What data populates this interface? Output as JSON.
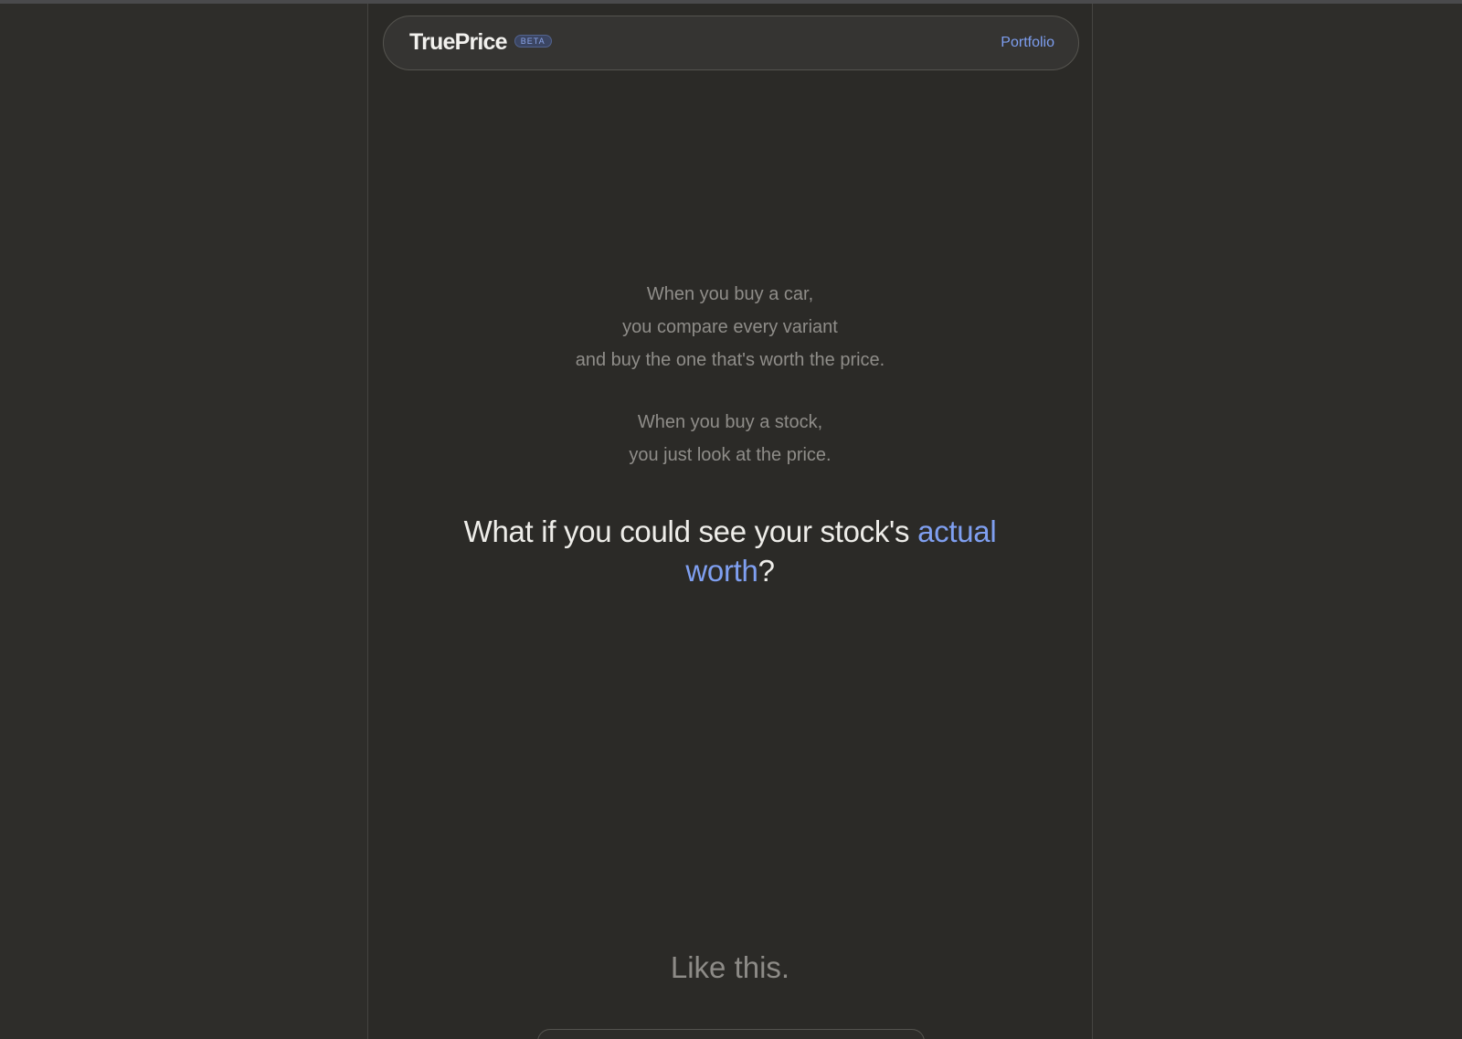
{
  "header": {
    "brand": "TruePrice",
    "badge": "BETA",
    "nav_link": "Portfolio"
  },
  "intro": {
    "car_lines": [
      "When you buy a car,",
      "you compare every variant",
      "and buy the one that's worth the price."
    ],
    "stock_lines": [
      "When you buy a stock,",
      "you just look at the price."
    ]
  },
  "headline": {
    "prefix": "What if you could see your stock's ",
    "highlight": "actual worth",
    "suffix": "?"
  },
  "demo": {
    "label": "Like this."
  },
  "colors": {
    "accent": "#7f9ff0",
    "background": "#2b2a27",
    "text_primary": "#eeede9",
    "text_muted": "#8f8d89"
  }
}
